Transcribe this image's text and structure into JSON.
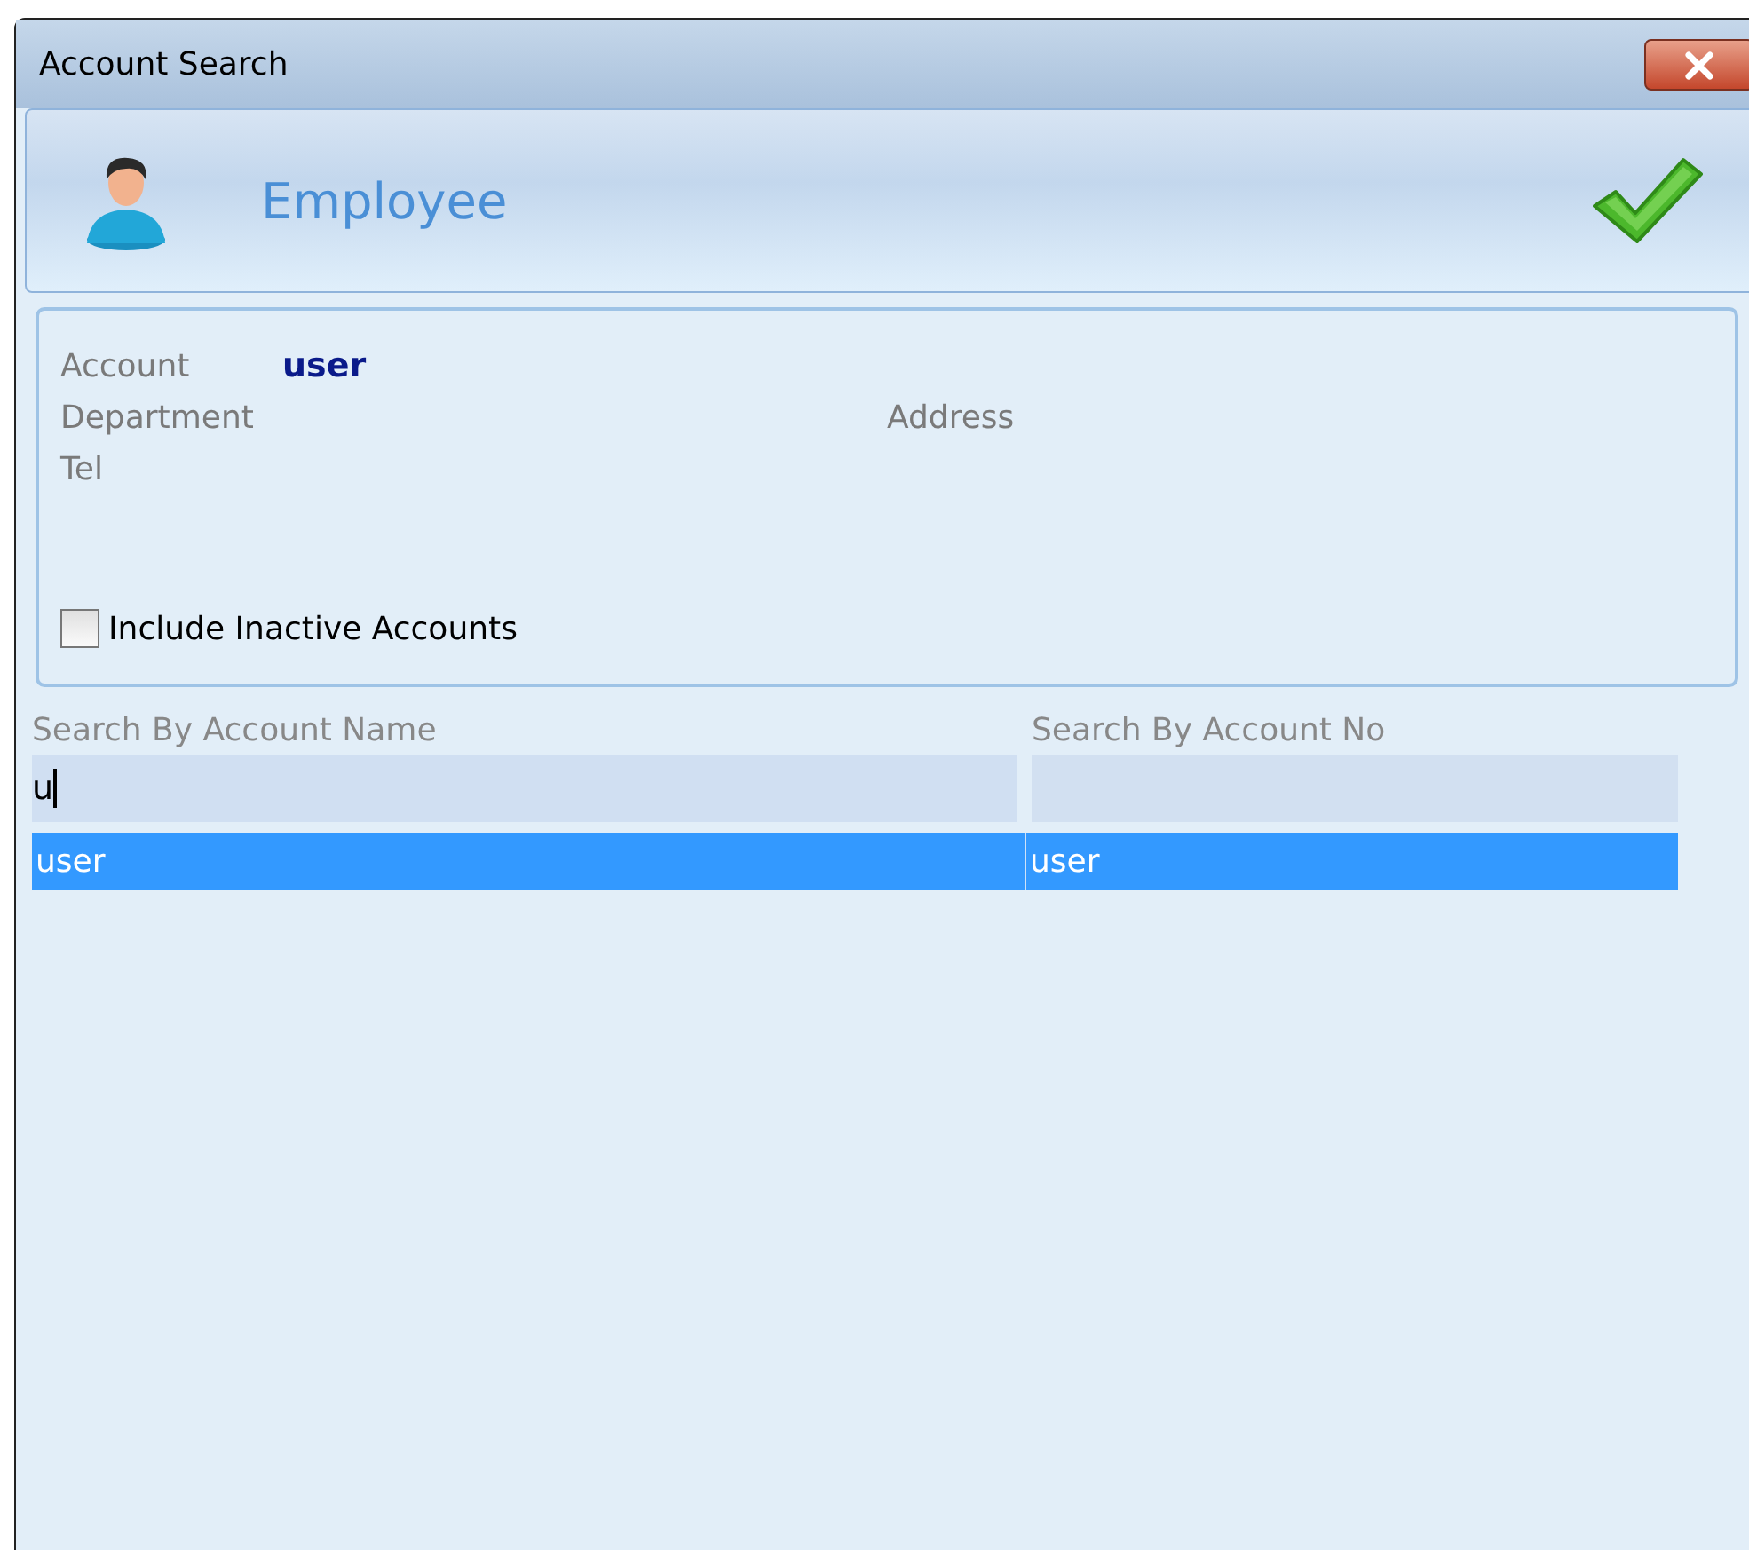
{
  "window": {
    "title": "Account Search"
  },
  "header": {
    "title": "Employee"
  },
  "details": [
    [
      {
        "label": "Account",
        "value": "user"
      }
    ],
    [
      {
        "label": "Department"
      },
      {
        "label": "Address"
      }
    ],
    [
      {
        "label": "Tel"
      }
    ]
  ],
  "include_inactive": {
    "label": "Include Inactive Accounts",
    "checked": false
  },
  "search_fields": [
    {
      "label": "Search By Account Name",
      "value": "u",
      "focused": true
    },
    {
      "label": "Search By Account No",
      "focused": false
    }
  ],
  "results": [
    {
      "cells": [
        "user",
        "user"
      ],
      "selected": true
    }
  ]
}
